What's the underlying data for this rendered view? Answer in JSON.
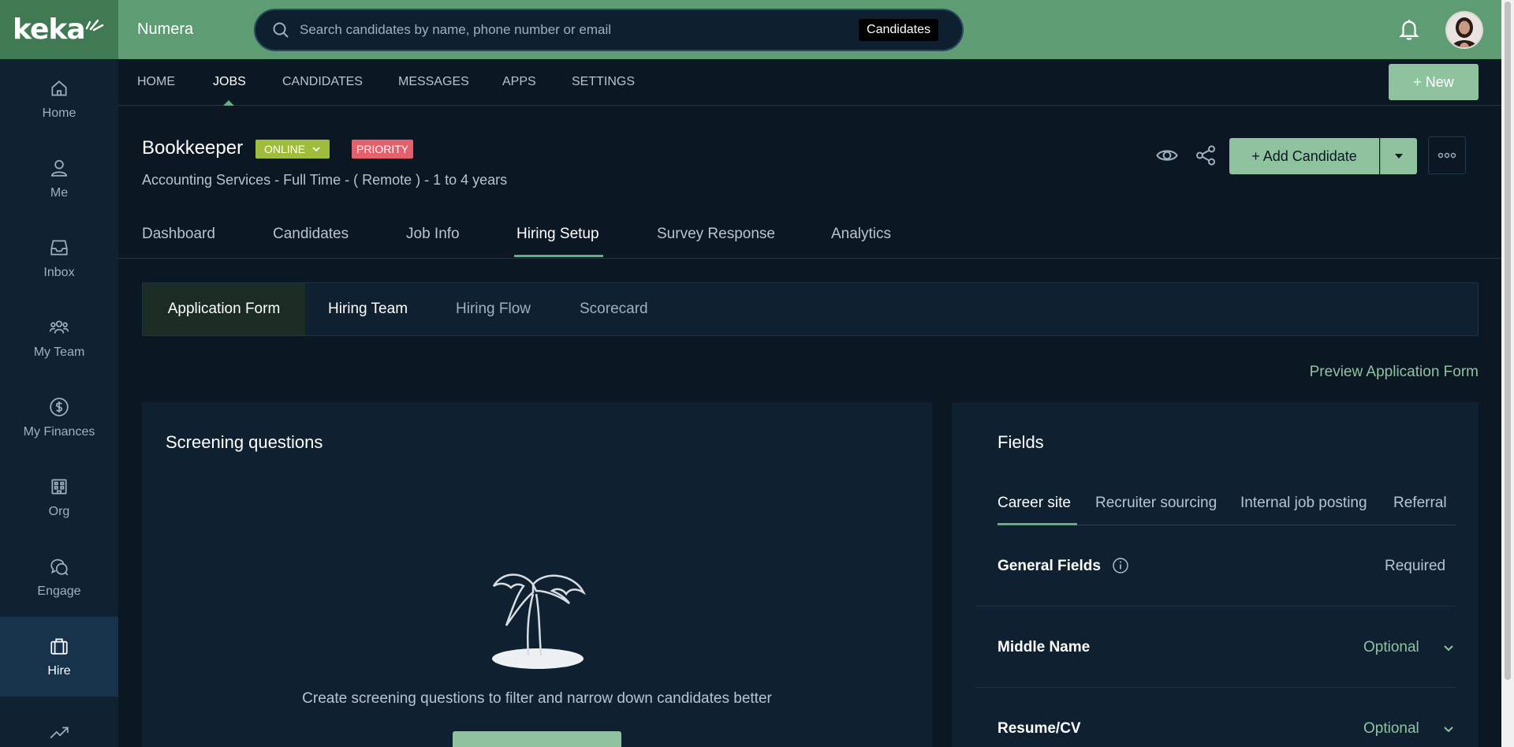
{
  "sidebar": {
    "logo": "keka",
    "items": [
      {
        "label": "Home",
        "icon": "home-icon"
      },
      {
        "label": "Me",
        "icon": "user-icon"
      },
      {
        "label": "Inbox",
        "icon": "inbox-icon"
      },
      {
        "label": "My Team",
        "icon": "team-icon"
      },
      {
        "label": "My Finances",
        "icon": "dollar-icon"
      },
      {
        "label": "Org",
        "icon": "building-icon"
      },
      {
        "label": "Engage",
        "icon": "chat-icon"
      },
      {
        "label": "Hire",
        "icon": "briefcase-icon",
        "active": true
      },
      {
        "label": "",
        "icon": "trend-icon"
      }
    ]
  },
  "topbar": {
    "company": "Numera",
    "search_placeholder": "Search candidates by name, phone number or email",
    "search_scope": "Candidates"
  },
  "mainnav": {
    "items": [
      "HOME",
      "JOBS",
      "CANDIDATES",
      "MESSAGES",
      "APPS",
      "SETTINGS"
    ],
    "active": "JOBS",
    "new_button": "+ New"
  },
  "job": {
    "title": "Bookkeeper",
    "status": "ONLINE",
    "priority": "PRIORITY",
    "subtitle": "Accounting Services - Full Time - ( Remote ) - 1 to 4 years",
    "add_candidate": "+ Add Candidate"
  },
  "jobtabs": {
    "items": [
      "Dashboard",
      "Candidates",
      "Job Info",
      "Hiring Setup",
      "Survey Response",
      "Analytics"
    ],
    "active": "Hiring Setup"
  },
  "subtabs": {
    "items": [
      "Application Form",
      "Hiring Team",
      "Hiring Flow",
      "Scorecard"
    ],
    "active": "Application Form"
  },
  "preview_link": "Preview Application Form",
  "screening": {
    "title": "Screening questions",
    "empty_text": "Create screening questions to filter and narrow down candidates better"
  },
  "fields": {
    "title": "Fields",
    "tabs": [
      "Career site",
      "Recruiter sourcing",
      "Internal job posting",
      "Referral"
    ],
    "active_tab": "Career site",
    "rows": [
      {
        "label": "General Fields",
        "value": "Required"
      },
      {
        "label": "Middle Name",
        "value": "Optional"
      },
      {
        "label": "Resume/CV",
        "value": "Optional"
      }
    ]
  },
  "colors": {
    "accent_green": "#5e9c74",
    "button_green": "#8fc29f",
    "online": "#9fbd3b",
    "priority": "#e5606c",
    "background": "#0b1824"
  }
}
